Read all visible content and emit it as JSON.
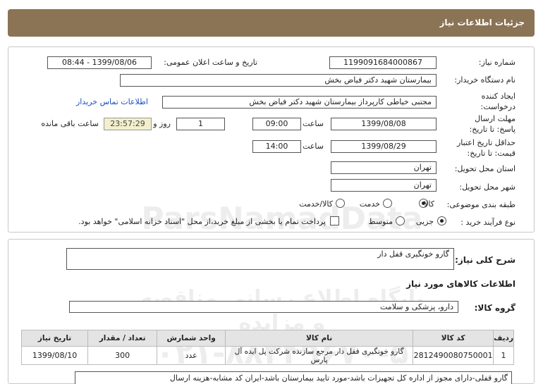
{
  "page_title": "جزئیات اطلاعات نیاز",
  "form": {
    "need_number_label": "شماره نیاز:",
    "need_number": "1199091684000867",
    "announce_label": "تاریخ و ساعت اعلان عمومی:",
    "announce_value": "1399/08/06 - 08:44",
    "buyer_label": "نام دستگاه خریدار:",
    "buyer_value": "بیمارستان شهید دکتر فیاض بخش",
    "creator_label": "ایجاد کننده درخواست:",
    "creator_value": "مجتبی خیاطی کارپرداز بیمارستان شهید دکتر فیاض بخش",
    "contact_link": "اطلاعات تماس خریدار",
    "deadline_label": "مهلت ارسال پاسخ: تا تاریخ:",
    "deadline_date": "1399/08/08",
    "time_label": "ساعت",
    "deadline_time": "09:00",
    "days_value": "1",
    "days_label": "روز و",
    "timer": "23:57:29",
    "remaining_label": "ساعت باقی مانده",
    "validity_label": "حداقل تاریخ اعتبار قیمت: تا تاریخ:",
    "validity_date": "1399/08/29",
    "validity_time": "14:00",
    "province_label": "استان محل تحویل:",
    "province_value": "تهران",
    "city_label": "شهر محل تحویل:",
    "city_value": "تهران",
    "category_label": "طبقه بندی موضوعی:",
    "category_options": [
      "کالا",
      "خدمت",
      "کالا/خدمت"
    ],
    "category_selected": "کالا",
    "process_label": "نوع فرآیند خرید :",
    "process_options": [
      "جزیی",
      "متوسط"
    ],
    "process_selected": "جزیی",
    "payment_note": "پرداخت تمام یا بخشی از مبلغ خرید،از محل \"اسناد خزانه اسلامی\" خواهد بود."
  },
  "summary": {
    "label": "شرح کلی نیاز:",
    "value": "گارو خونگیری قفل دار"
  },
  "goods": {
    "section_title": "اطلاعات کالاهای مورد نیاز",
    "group_label": "گروه کالا:",
    "group_value": "دارو، پزشکی و سلامت",
    "columns": [
      "ردیف",
      "کد کالا",
      "نام کالا",
      "واحد شمارش",
      "تعداد / مقدار",
      "تاریخ نیاز"
    ],
    "rows": [
      [
        "1",
        "2812490080750001",
        "گارو خونگیری قفل دار مرجع سازنده شرکت پل ایده آل پارس",
        "عدد",
        "300",
        "1399/08/10"
      ]
    ],
    "description": "گارو قفلی-دارای مجوز از اداره کل تجهیزات باشد-مورد تایید بیمارستان باشد-ایران کد مشابه-هزینه ارسال"
  },
  "watermark": {
    "line1": "ParsNamadData",
    "line2": "پایگاه اطلاع رسانی مناقصه و مزایده",
    "line3": "۰۲۱-۸۸۳۴۹۶۷۰-۵"
  }
}
